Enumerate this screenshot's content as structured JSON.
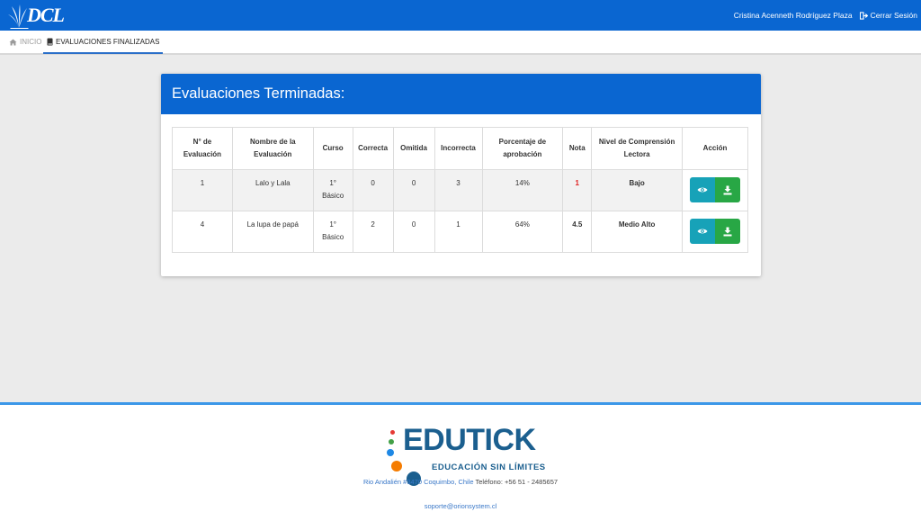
{
  "header": {
    "logo_text": "DCL",
    "user_name": "Cristina Acenneth Rodríguez Plaza",
    "logout_label": "Cerrar Sesión",
    "bg_color": "#0a66d1"
  },
  "nav": {
    "home_label": "INICIO",
    "current_label": "EVALUACIONES FINALIZADAS"
  },
  "card": {
    "title": "Evaluaciones Terminadas:"
  },
  "table": {
    "columns": [
      "N° de\nEvaluación",
      "Nombre de la\nEvaluación",
      "Curso",
      "Correcta",
      "Omitida",
      "Incorrecta",
      "Porcentaje de\naprobación",
      "Nota",
      "Nivel de Comprensión\nLectora",
      "Acción"
    ],
    "rows": [
      {
        "numero": "1",
        "nombre": "Lalo y Lala",
        "curso": "1°\nBásico",
        "correcta": "0",
        "omitida": "0",
        "incorrecta": "3",
        "porcentaje": "14%",
        "nota": "1",
        "nivel": "Bajo"
      },
      {
        "numero": "4",
        "nombre": "La lupa de papá",
        "curso": "1°\nBásico",
        "correcta": "2",
        "omitida": "0",
        "incorrecta": "1",
        "porcentaje": "64%",
        "nota": "4.5",
        "nivel": "Medio Alto"
      }
    ],
    "action_icons": [
      "eye-icon",
      "download-icon"
    ],
    "failing_grade_color": "#e02020"
  },
  "footer": {
    "brand_name": "EDUTICK",
    "brand_tagline": "EDUCACIÓN SIN LÍMITES",
    "address": "Rio Andalién #3470 Coquimbo, Chile",
    "phone": "Teléfono: +56 51 - 2485657",
    "email": "soporte@orionsystem.cl"
  }
}
